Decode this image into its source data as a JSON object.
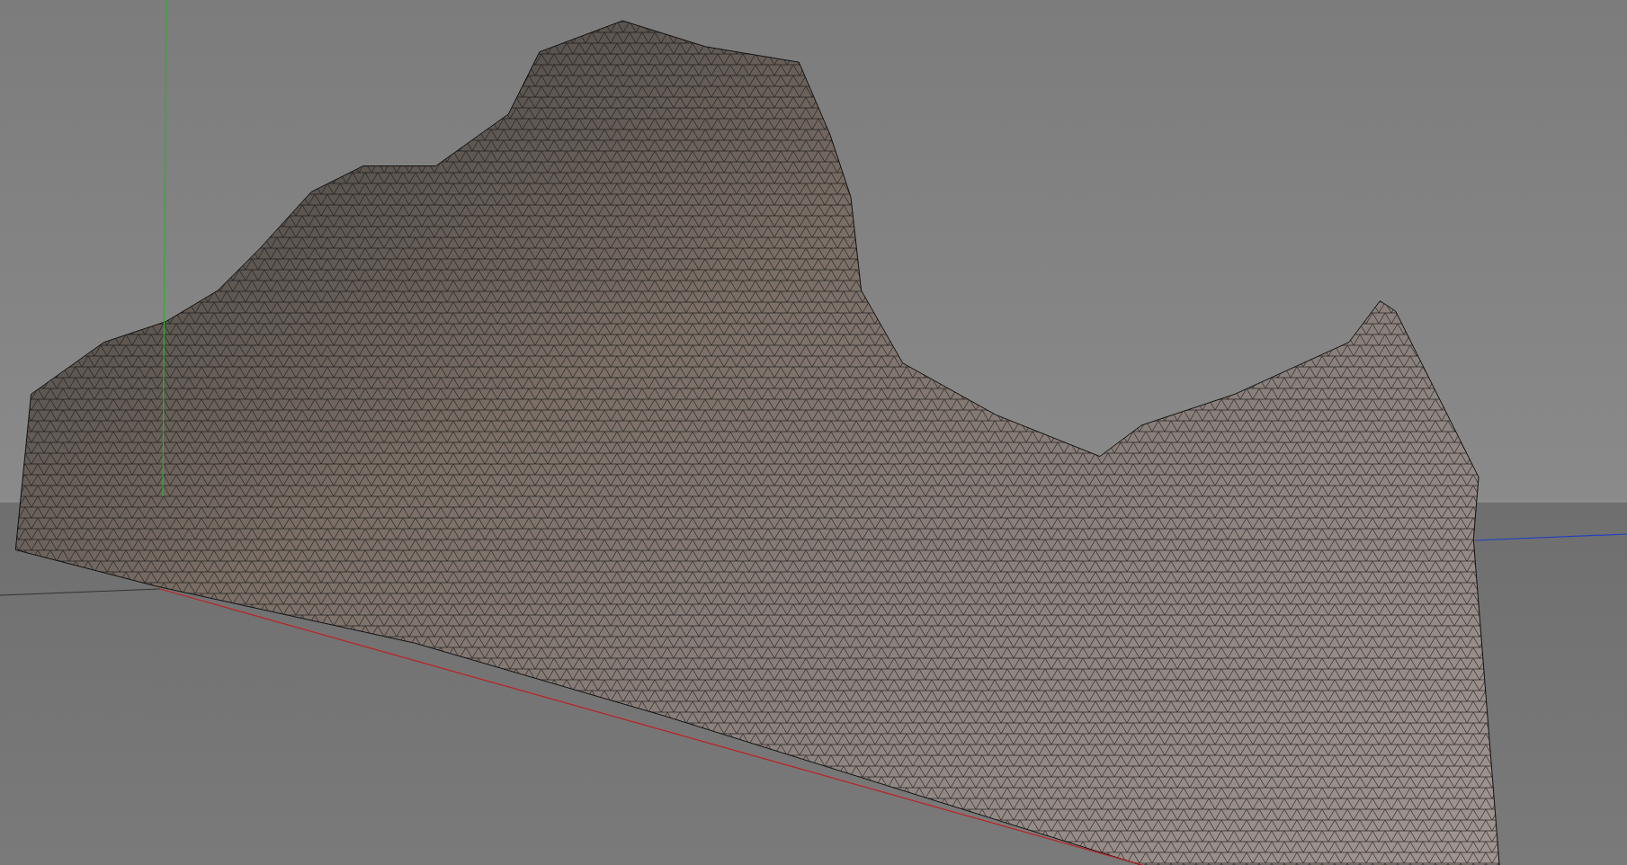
{
  "viewport": {
    "axes_visible": true,
    "wireframe": true
  }
}
